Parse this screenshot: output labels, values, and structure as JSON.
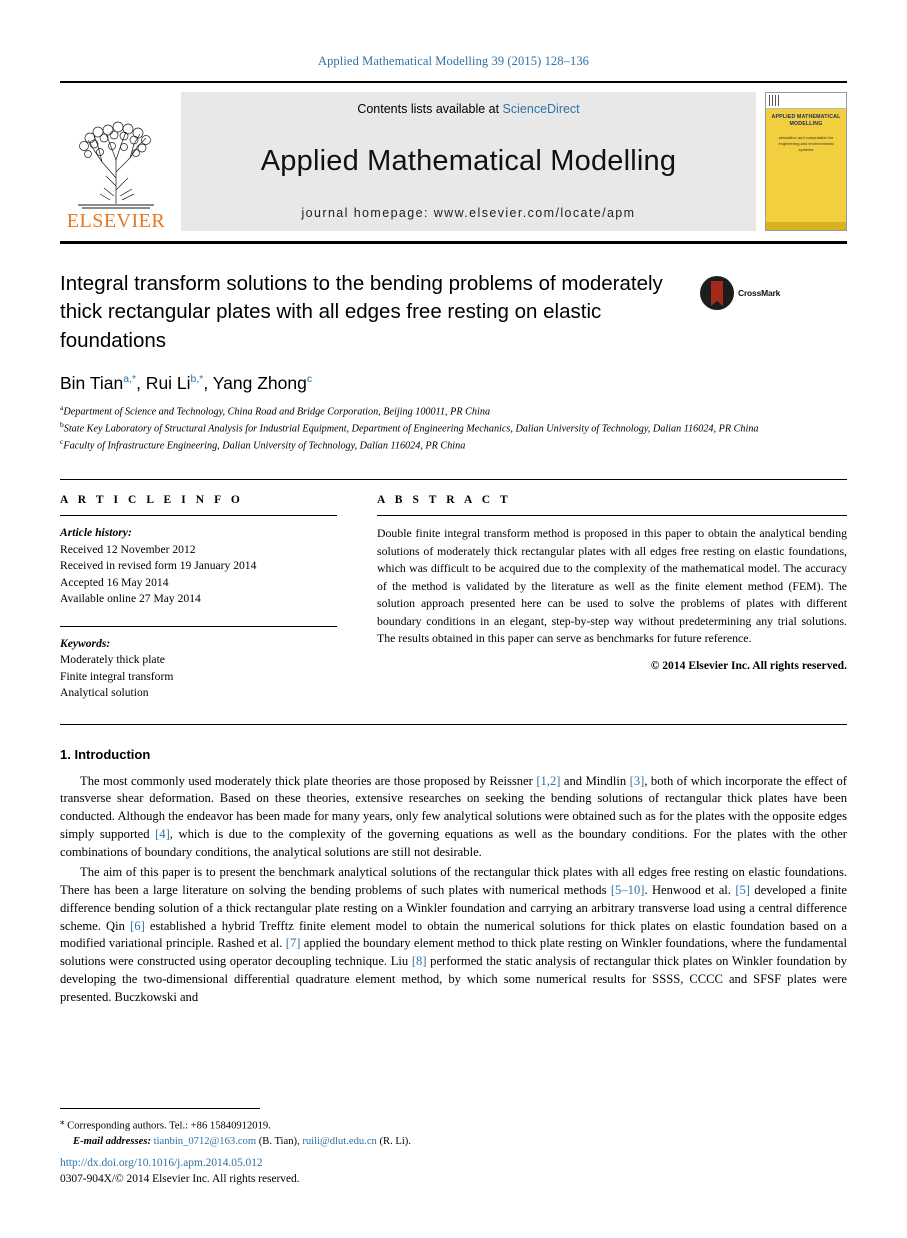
{
  "running_head": "Applied Mathematical Modelling 39 (2015) 128–136",
  "masthead": {
    "publisher": "ELSEVIER",
    "publisher_logo": "elsevier-tree-logo",
    "contents_prefix": "Contents lists available at ",
    "contents_link": "ScienceDirect",
    "journal_name": "Applied Mathematical Modelling",
    "homepage": "journal homepage: www.elsevier.com/locate/apm",
    "cover": {
      "title": "APPLIED MATHEMATICAL MODELLING",
      "subtitle": "simulation and computation for engineering and environmental systems"
    }
  },
  "article": {
    "title": "Integral transform solutions to the bending problems of moderately thick rectangular plates with all edges free resting on elastic foundations",
    "crossmark_label": "CrossMark",
    "authors_html": "Bin Tian<sup>a,*</sup>, Rui Li<sup>b,*</sup>, Yang Zhong<sup>c</sup>",
    "affiliations": [
      "Department of Science and Technology, China Road and Bridge Corporation, Beijing 100011, PR China",
      "State Key Laboratory of Structural Analysis for Industrial Equipment, Department of Engineering Mechanics, Dalian University of Technology, Dalian 116024, PR China",
      "Faculty of Infrastructure Engineering, Dalian University of Technology, Dalian 116024, PR China"
    ]
  },
  "article_info": {
    "heading": "A R T I C L E  I N F O",
    "history_label": "Article history:",
    "history": [
      "Received 12 November 2012",
      "Received in revised form 19 January 2014",
      "Accepted 16 May 2014",
      "Available online 27 May 2014"
    ],
    "keywords_label": "Keywords:",
    "keywords": [
      "Moderately thick plate",
      "Finite integral transform",
      "Analytical solution"
    ]
  },
  "abstract": {
    "heading": "A B S T R A C T",
    "text": "Double finite integral transform method is proposed in this paper to obtain the analytical bending solutions of moderately thick rectangular plates with all edges free resting on elastic foundations, which was difficult to be acquired due to the complexity of the mathematical model. The accuracy of the method is validated by the literature as well as the finite element method (FEM). The solution approach presented here can be used to solve the problems of plates with different boundary conditions in an elegant, step-by-step way without predetermining any trial solutions. The results obtained in this paper can serve as benchmarks for future reference.",
    "copyright": "© 2014 Elsevier Inc. All rights reserved."
  },
  "introduction": {
    "heading": "1. Introduction",
    "paragraph1_parts": [
      "The most commonly used moderately thick plate theories are those proposed by Reissner ",
      "[1,2]",
      " and Mindlin ",
      "[3]",
      ", both of which incorporate the effect of transverse shear deformation. Based on these theories, extensive researches on seeking the bending solutions of rectangular thick plates have been conducted. Although the endeavor has been made for many years, only few analytical solutions were obtained such as for the plates with the opposite edges simply supported ",
      "[4]",
      ", which is due to the complexity of the governing equations as well as the boundary conditions. For the plates with the other combinations of boundary conditions, the analytical solutions are still not desirable."
    ],
    "paragraph2_parts": [
      "The aim of this paper is to present the benchmark analytical solutions of the rectangular thick plates with all edges free resting on elastic foundations. There has been a large literature on solving the bending problems of such plates with numerical methods ",
      "[5–10]",
      ". Henwood et al. ",
      "[5]",
      " developed a finite difference bending solution of a thick rectangular plate resting on a Winkler foundation and carrying an arbitrary transverse load using a central difference scheme. Qin ",
      "[6]",
      " established a hybrid Trefftz finite element model to obtain the numerical solutions for thick plates on elastic foundation based on a modified variational principle. Rashed et al. ",
      "[7]",
      " applied the boundary element method to thick plate resting on Winkler foundations, where the fundamental solutions were constructed using operator decoupling technique. Liu ",
      "[8]",
      " performed the static analysis of rectangular thick plates on Winkler foundation by developing the two-dimensional differential quadrature element method, by which some numerical results for SSSS, CCCC and SFSF plates were presented. Buczkowski and"
    ]
  },
  "footer": {
    "corresponding": "Corresponding authors. Tel.: +86 15840912019.",
    "email_label": "E-mail addresses:",
    "emails": [
      {
        "address": "tianbin_0712@163.com",
        "owner": "(B. Tian)"
      },
      {
        "address": "ruili@dlut.edu.cn",
        "owner": "(R. Li)"
      }
    ],
    "doi": "http://dx.doi.org/10.1016/j.apm.2014.05.012",
    "issn_line": "0307-904X/© 2014 Elsevier Inc. All rights reserved."
  },
  "colors": {
    "link": "#2e72a8",
    "elsevier_orange": "#e87722",
    "cover_yellow": "#f2cf3f",
    "banner_gray": "#e8e8e8"
  }
}
